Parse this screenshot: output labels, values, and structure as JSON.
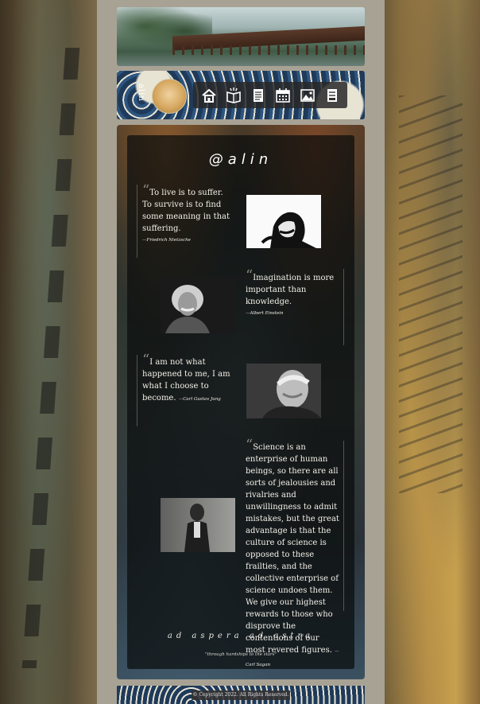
{
  "header": {
    "avatar_label": "alin"
  },
  "nav": {
    "items": [
      {
        "name": "home-icon"
      },
      {
        "name": "book-open-icon"
      },
      {
        "name": "document-icon"
      },
      {
        "name": "calendar-icon"
      },
      {
        "name": "image-icon"
      },
      {
        "name": "note-icon"
      }
    ]
  },
  "main": {
    "title": "@alin",
    "quotes": [
      {
        "text": "To live is to suffer. To survive is to find some meaning in that suffering.",
        "author": "—Friedrich Nietzsche"
      },
      {
        "text": "Imagination is more important than knowledge.",
        "author": "—Albert Einstein"
      },
      {
        "text": "I am not what happened to me, I am what I choose to become.",
        "author": "—Carl Gustav Jung"
      },
      {
        "text": "Science is an enterprise of human beings, so there are all sorts of jealousies and rivalries and unwillingness to admit mistakes, but the great advantage is that the culture of science is opposed to these frailties, and the collective enterprise of science undoes them. We give our highest rewards to those who disprove the contentions of our most revered figures.",
        "author": "—Carl Sagan"
      }
    ],
    "motto": "ad aspera ad astra",
    "motto_translation": "\"through hardships to the stars\""
  },
  "footer": {
    "copyright": "© Copyright 2022. All Rights Reserved."
  }
}
